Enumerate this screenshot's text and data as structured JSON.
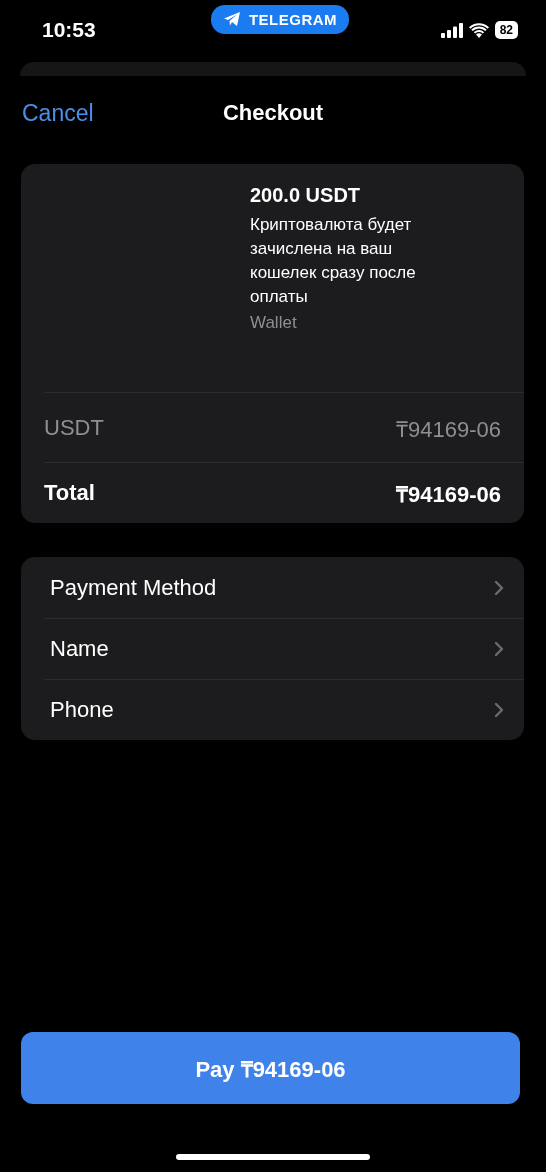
{
  "status_bar": {
    "time": "10:53",
    "app_pill": "TELEGRAM",
    "battery": "82"
  },
  "nav": {
    "cancel": "Cancel",
    "title": "Checkout"
  },
  "product": {
    "title": "200.0 USDT",
    "description": "Криптовалюта будет зачислена на ваш кошелек сразу после оплаты",
    "provider": "Wallet"
  },
  "price_rows": [
    {
      "kind": "item",
      "label": "USDT",
      "amount": "₸94169-06"
    },
    {
      "kind": "total",
      "label": "Total",
      "amount": "₸94169-06"
    }
  ],
  "fields": [
    {
      "label": "Payment Method"
    },
    {
      "label": "Name"
    },
    {
      "label": "Phone"
    }
  ],
  "pay_button": "Pay ₸94169-06"
}
